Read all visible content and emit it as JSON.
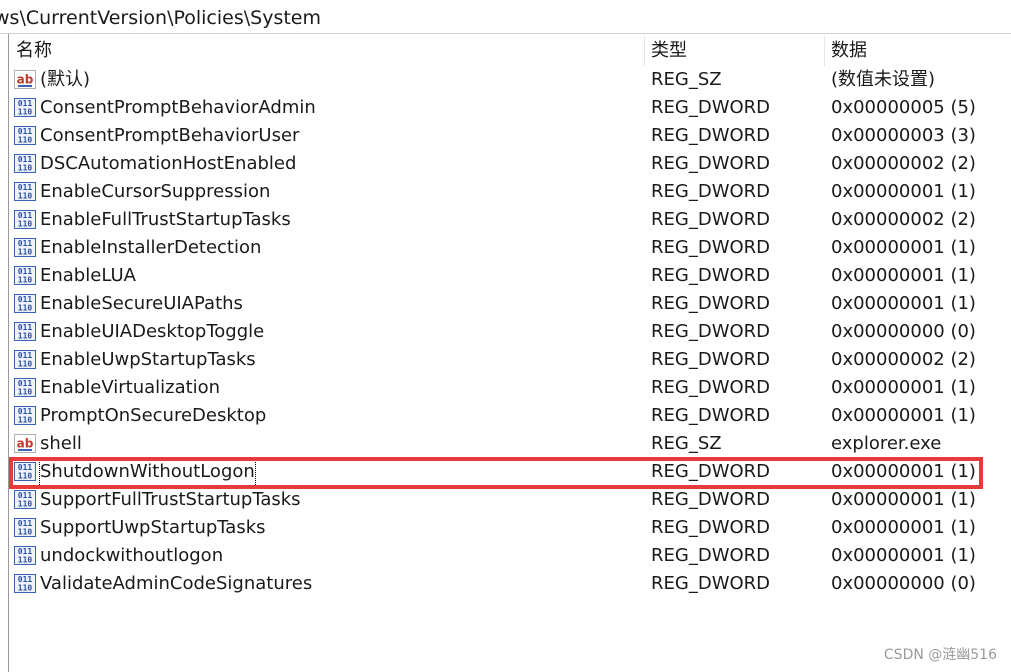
{
  "path": "ws\\CurrentVersion\\Policies\\System",
  "columns": {
    "name": "名称",
    "type": "类型",
    "data": "数据"
  },
  "rows": [
    {
      "icon": "string-value-icon",
      "name": "(默认)",
      "type": "REG_SZ",
      "data": "(数值未设置)"
    },
    {
      "icon": "dword-value-icon",
      "name": "ConsentPromptBehaviorAdmin",
      "type": "REG_DWORD",
      "data": "0x00000005 (5)"
    },
    {
      "icon": "dword-value-icon",
      "name": "ConsentPromptBehaviorUser",
      "type": "REG_DWORD",
      "data": "0x00000003 (3)"
    },
    {
      "icon": "dword-value-icon",
      "name": "DSCAutomationHostEnabled",
      "type": "REG_DWORD",
      "data": "0x00000002 (2)"
    },
    {
      "icon": "dword-value-icon",
      "name": "EnableCursorSuppression",
      "type": "REG_DWORD",
      "data": "0x00000001 (1)"
    },
    {
      "icon": "dword-value-icon",
      "name": "EnableFullTrustStartupTasks",
      "type": "REG_DWORD",
      "data": "0x00000002 (2)"
    },
    {
      "icon": "dword-value-icon",
      "name": "EnableInstallerDetection",
      "type": "REG_DWORD",
      "data": "0x00000001 (1)"
    },
    {
      "icon": "dword-value-icon",
      "name": "EnableLUA",
      "type": "REG_DWORD",
      "data": "0x00000001 (1)"
    },
    {
      "icon": "dword-value-icon",
      "name": "EnableSecureUIAPaths",
      "type": "REG_DWORD",
      "data": "0x00000001 (1)"
    },
    {
      "icon": "dword-value-icon",
      "name": "EnableUIADesktopToggle",
      "type": "REG_DWORD",
      "data": "0x00000000 (0)"
    },
    {
      "icon": "dword-value-icon",
      "name": "EnableUwpStartupTasks",
      "type": "REG_DWORD",
      "data": "0x00000002 (2)"
    },
    {
      "icon": "dword-value-icon",
      "name": "EnableVirtualization",
      "type": "REG_DWORD",
      "data": "0x00000001 (1)"
    },
    {
      "icon": "dword-value-icon",
      "name": "PromptOnSecureDesktop",
      "type": "REG_DWORD",
      "data": "0x00000001 (1)"
    },
    {
      "icon": "string-value-icon",
      "name": "shell",
      "type": "REG_SZ",
      "data": "explorer.exe"
    },
    {
      "icon": "dword-value-icon",
      "name": "ShutdownWithoutLogon",
      "type": "REG_DWORD",
      "data": "0x00000001 (1)",
      "focused": true
    },
    {
      "icon": "dword-value-icon",
      "name": "SupportFullTrustStartupTasks",
      "type": "REG_DWORD",
      "data": "0x00000001 (1)"
    },
    {
      "icon": "dword-value-icon",
      "name": "SupportUwpStartupTasks",
      "type": "REG_DWORD",
      "data": "0x00000001 (1)"
    },
    {
      "icon": "dword-value-icon",
      "name": "undockwithoutlogon",
      "type": "REG_DWORD",
      "data": "0x00000001 (1)"
    },
    {
      "icon": "dword-value-icon",
      "name": "ValidateAdminCodeSignatures",
      "type": "REG_DWORD",
      "data": "0x00000000 (0)"
    }
  ],
  "highlight_color": "#e83a3a",
  "watermark": "CSDN @涟幽516"
}
